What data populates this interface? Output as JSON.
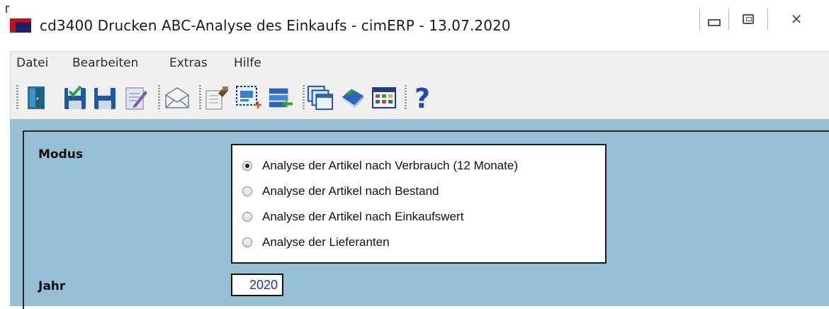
{
  "window": {
    "title": "cd3400 Drucken ABC-Analyse des Einkaufs - cimERP - 13.07.2020"
  },
  "menu": [
    "Datei",
    "Bearbeiten",
    "Extras",
    "Hilfe"
  ],
  "toolbar": {
    "buttons": [
      "exit-icon",
      "save-and-close-icon",
      "save-icon",
      "edit-icon",
      "mail-icon",
      "properties-icon",
      "new-record-icon",
      "transfer-icon",
      "windows-icon",
      "book-icon",
      "table-icon",
      "help-icon"
    ]
  },
  "form": {
    "modus_label": "Modus",
    "modus_options": [
      {
        "label": "Analyse der Artikel nach Verbrauch (12 Monate)",
        "checked": true
      },
      {
        "label": "Analyse der Artikel nach Bestand",
        "checked": false
      },
      {
        "label": "Analyse der Artikel nach Einkaufswert",
        "checked": false
      },
      {
        "label": "Analyse der Lieferanten",
        "checked": false
      }
    ],
    "jahr_label": "Jahr",
    "jahr_value": "2020"
  },
  "colors": {
    "panel_bg": "#96bfd6",
    "input_text": "#1a2ec8"
  }
}
